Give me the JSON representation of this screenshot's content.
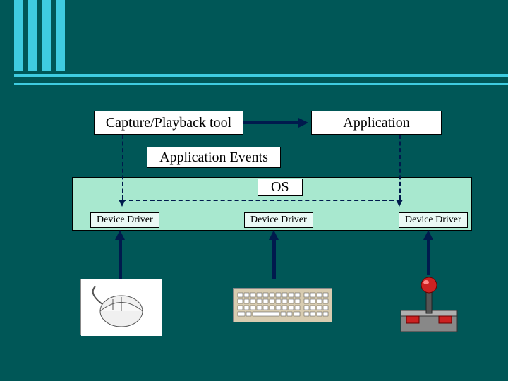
{
  "diagram": {
    "capture_playback": "Capture/Playback tool",
    "application": "Application",
    "app_events": "Application Events",
    "os": "OS",
    "device_driver_1": "Device Driver",
    "device_driver_2": "Device Driver",
    "device_driver_3": "Device Driver",
    "devices": {
      "mouse": "mouse",
      "keyboard": "keyboard",
      "joystick": "joystick"
    }
  },
  "colors": {
    "background": "#005757",
    "accent": "#3fcce0",
    "os_fill": "#a8e8cf",
    "dd_fill": "#eaf9f5",
    "arrow": "#001a4d"
  }
}
